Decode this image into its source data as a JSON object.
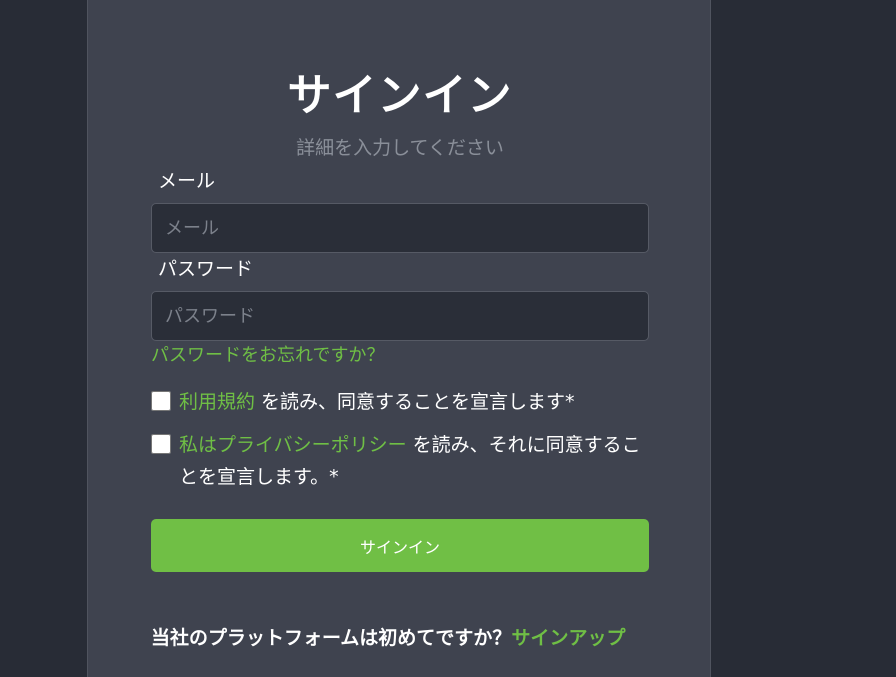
{
  "form": {
    "title": "サインイン",
    "subtitle": "詳細を入力してください",
    "email_label": "メール",
    "email_placeholder": "メール",
    "email_value": "",
    "password_label": "パスワード",
    "password_placeholder": "パスワード",
    "password_value": "",
    "forgot_link": "パスワードをお忘れですか？",
    "terms": {
      "checked": false,
      "link": "利用規約",
      "text": " を読み、同意することを宣言します*"
    },
    "privacy": {
      "checked": false,
      "link": "私はプライバシーポリシー",
      "text": " を読み、それに同意することを宣言します。*"
    },
    "submit_label": "サインイン",
    "footer_text": "当社のプラットフォームは初めてですか？",
    "signup_link": "サインアップ"
  },
  "colors": {
    "background": "#282c36",
    "card": "#3f434f",
    "accent": "#70bf45",
    "input_bg": "#2a2e38"
  }
}
